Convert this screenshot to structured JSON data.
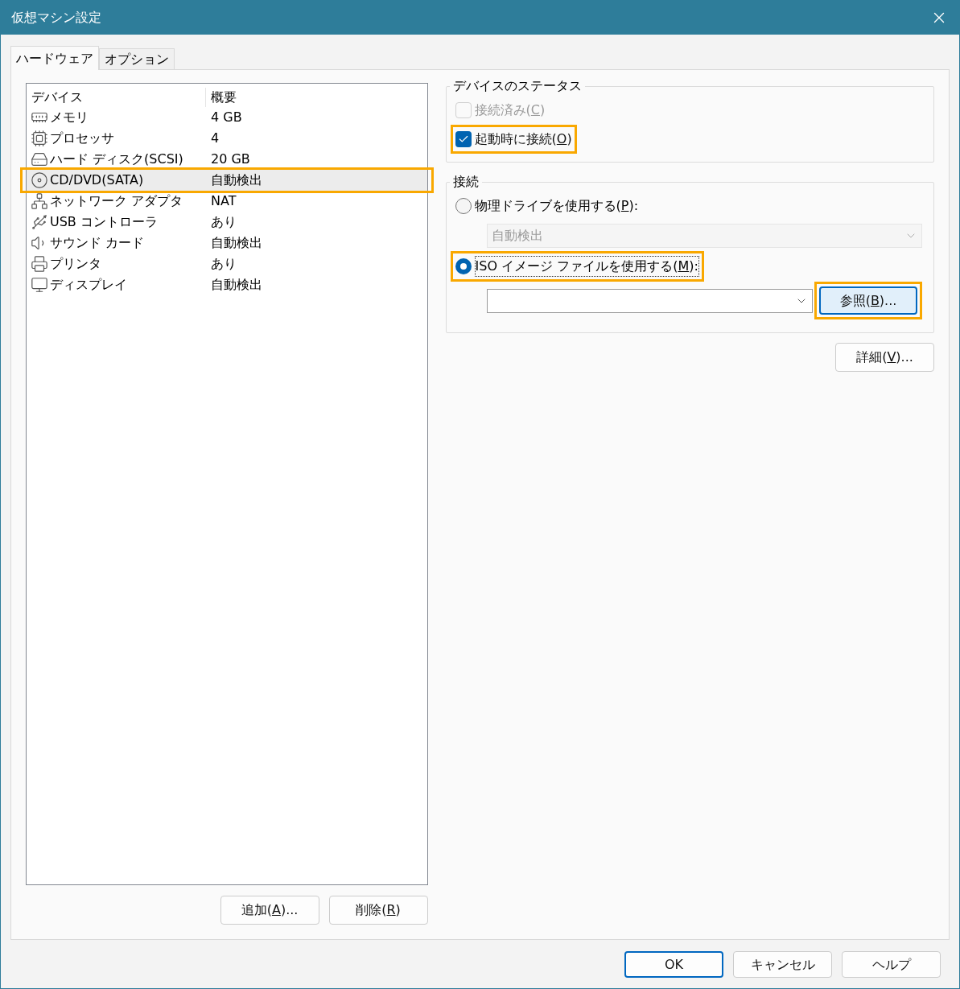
{
  "window": {
    "title": "仮想マシン設定"
  },
  "tabs": [
    {
      "label": "ハードウェア",
      "selected": true
    },
    {
      "label": "オプション",
      "selected": false
    }
  ],
  "device_table": {
    "columns": [
      "デバイス",
      "概要"
    ],
    "rows": [
      {
        "kind": "memory",
        "device": "メモリ",
        "summary": "4 GB",
        "selected": false,
        "highlighted": false
      },
      {
        "kind": "cpu",
        "device": "プロセッサ",
        "summary": "4",
        "selected": false,
        "highlighted": false
      },
      {
        "kind": "disk",
        "device": "ハード ディスク(SCSI)",
        "summary": "20 GB",
        "selected": false,
        "highlighted": false
      },
      {
        "kind": "disc",
        "device": "CD/DVD(SATA)",
        "summary": "自動検出",
        "selected": true,
        "highlighted": true
      },
      {
        "kind": "network",
        "device": "ネットワーク アダプタ",
        "summary": "NAT",
        "selected": false,
        "highlighted": false
      },
      {
        "kind": "usb",
        "device": "USB コントローラ",
        "summary": "あり",
        "selected": false,
        "highlighted": false
      },
      {
        "kind": "sound",
        "device": "サウンド カード",
        "summary": "自動検出",
        "selected": false,
        "highlighted": false
      },
      {
        "kind": "printer",
        "device": "プリンタ",
        "summary": "あり",
        "selected": false,
        "highlighted": false
      },
      {
        "kind": "display",
        "device": "ディスプレイ",
        "summary": "自動検出",
        "selected": false,
        "highlighted": false
      }
    ]
  },
  "list_buttons": [
    {
      "before": "追加(",
      "key": "A",
      "after": ")..."
    },
    {
      "before": "削除(",
      "key": "R",
      "after": ")"
    }
  ],
  "device_status": {
    "title": "デバイスのステータス",
    "options": [
      {
        "before": "接続済み(",
        "key": "C",
        "after": ")",
        "checked": false,
        "disabled": true,
        "highlighted": false
      },
      {
        "before": "起動時に接続(",
        "key": "O",
        "after": ")",
        "checked": true,
        "disabled": false,
        "highlighted": true
      }
    ]
  },
  "connection": {
    "title": "接続",
    "physical": {
      "before": "物理ドライブを使用する(",
      "key": "P",
      "after": "):",
      "selected": false,
      "highlighted": false,
      "dropdown_value": "自動検出",
      "dropdown_disabled": true
    },
    "iso": {
      "before": "ISO イメージ ファイルを使用する(",
      "key": "M",
      "after": "):",
      "selected": true,
      "highlighted": true,
      "browse": {
        "before": "参照(",
        "key": "B",
        "after": ")...",
        "highlighted": true
      }
    }
  },
  "advanced_button": {
    "before": "詳細(",
    "key": "V",
    "after": ")..."
  },
  "footer_buttons": [
    {
      "label": "OK",
      "default": true
    },
    {
      "label": "キャンセル",
      "default": false
    },
    {
      "label": "ヘルプ",
      "default": false
    }
  ]
}
